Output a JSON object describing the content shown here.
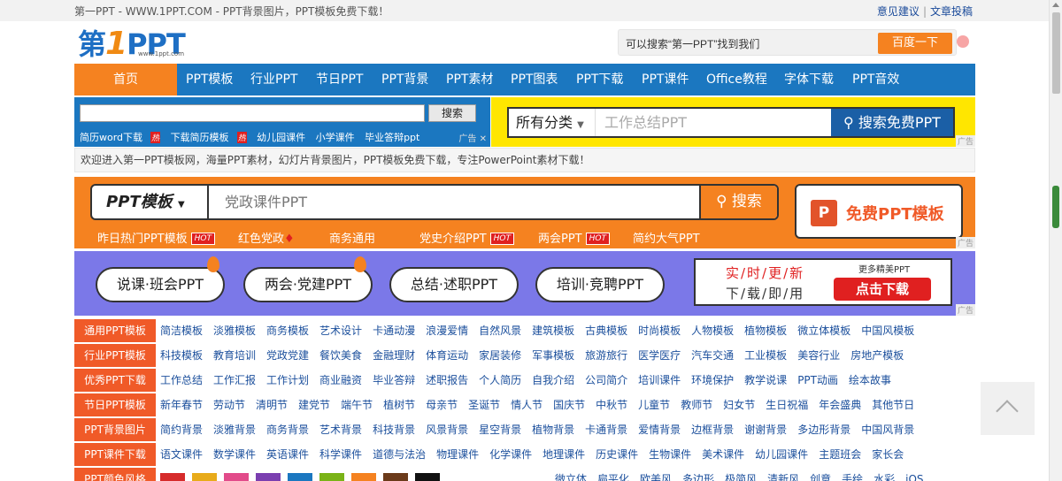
{
  "top": {
    "tagline": "第一PPT - WWW.1PPT.COM - PPT背景图片，PPT模板免费下载！",
    "feedback": "意见建议",
    "sep": "|",
    "submit": "文章投稿"
  },
  "logo": {
    "text_pre": "第",
    "text_one": "1",
    "text_post": "PPT",
    "small": "www.1ppt.com"
  },
  "header_search": {
    "placeholder": "可以搜索“第一PPT”找到我们",
    "button": "百度一下"
  },
  "nav": {
    "home": "首页",
    "items": [
      "PPT模板",
      "行业PPT",
      "节日PPT",
      "PPT背景",
      "PPT素材",
      "PPT图表",
      "PPT下载",
      "PPT课件",
      "Office教程",
      "字体下载",
      "PPT音效"
    ]
  },
  "ad_left": {
    "search_button": "搜索",
    "links": [
      "简历word下载",
      "下载简历模板",
      "幼儿园课件",
      "小学课件",
      "毕业答辩ppt"
    ],
    "hot": "热",
    "ad_label": "广告",
    "close": "✕"
  },
  "ad_right": {
    "category": "所有分类",
    "placeholder": "工作总结PPT",
    "button": "搜索免费PPT",
    "ad_label": "广告"
  },
  "welcome": "欢迎进入第一PPT模板网，海量PPT素材，幻灯片背景图片，PPT模板免费下载，专注PowerPoint素材下载！",
  "orange_banner": {
    "category": "PPT模板",
    "placeholder": "党政课件PPT",
    "search": "搜索",
    "free_logo": "P",
    "free": "免费PPT模板",
    "hot_badge": "HOT",
    "tags": [
      "昨日热门PPT模板",
      "红色党政",
      "商务通用",
      "党史介绍PPT",
      "两会PPT",
      "简约大气PPT"
    ],
    "ad_label": "广告"
  },
  "purple_banner": {
    "pills": [
      "说课·班会PPT",
      "两会·党建PPT",
      "总结·述职PPT",
      "培训·竞聘PPT"
    ],
    "line1": "实/时/更/新",
    "line2": "下/载/即/用",
    "more": "更多精美PPT",
    "download": "点击下载",
    "ad_label": "广告"
  },
  "categories": [
    {
      "label": "通用PPT模板",
      "links": [
        "简洁模板",
        "淡雅模板",
        "商务模板",
        "艺术设计",
        "卡通动漫",
        "浪漫爱情",
        "自然风景",
        "建筑模板",
        "古典模板",
        "时尚模板",
        "人物模板",
        "植物模板",
        "微立体模板",
        "中国风模板"
      ]
    },
    {
      "label": "行业PPT模板",
      "links": [
        "科技模板",
        "教育培训",
        "党政党建",
        "餐饮美食",
        "金融理财",
        "体育运动",
        "家居装修",
        "军事模板",
        "旅游旅行",
        "医学医疗",
        "汽车交通",
        "工业模板",
        "美容行业",
        "房地产模板"
      ]
    },
    {
      "label": "优秀PPT下载",
      "links": [
        "工作总结",
        "工作汇报",
        "工作计划",
        "商业融资",
        "毕业答辩",
        "述职报告",
        "个人简历",
        "自我介绍",
        "公司简介",
        "培训课件",
        "环境保护",
        "教学说课",
        "PPT动画",
        "绘本故事"
      ]
    },
    {
      "label": "节日PPT模板",
      "links": [
        "新年春节",
        "劳动节",
        "清明节",
        "建党节",
        "端午节",
        "植树节",
        "母亲节",
        "圣诞节",
        "情人节",
        "国庆节",
        "中秋节",
        "儿童节",
        "教师节",
        "妇女节",
        "生日祝福",
        "年会盛典",
        "其他节日"
      ]
    },
    {
      "label": "PPT背景图片",
      "links": [
        "简约背景",
        "淡雅背景",
        "商务背景",
        "艺术背景",
        "科技背景",
        "风景背景",
        "星空背景",
        "植物背景",
        "卡通背景",
        "爱情背景",
        "边框背景",
        "谢谢背景",
        "多边形背景",
        "中国风背景"
      ]
    },
    {
      "label": "PPT课件下载",
      "links": [
        "语文课件",
        "数学课件",
        "英语课件",
        "科学课件",
        "道德与法治",
        "物理课件",
        "化学课件",
        "地理课件",
        "历史课件",
        "生物课件",
        "美术课件",
        "幼儿园课件",
        "主题班会",
        "家长会"
      ]
    },
    {
      "label": "PPT颜色风格",
      "links": [
        "微立体",
        "扁平化",
        "欧美风",
        "多边形",
        "极简风",
        "清新风",
        "创意",
        "手绘",
        "水彩",
        "iOS"
      ]
    }
  ],
  "swatch_colors": [
    "#d62b2b",
    "#e8ab1a",
    "#e24b8a",
    "#7b3fb0",
    "#1b77c0",
    "#7ab317",
    "#f58220",
    "#6b3a1a",
    "#111111",
    "#ffffff"
  ]
}
